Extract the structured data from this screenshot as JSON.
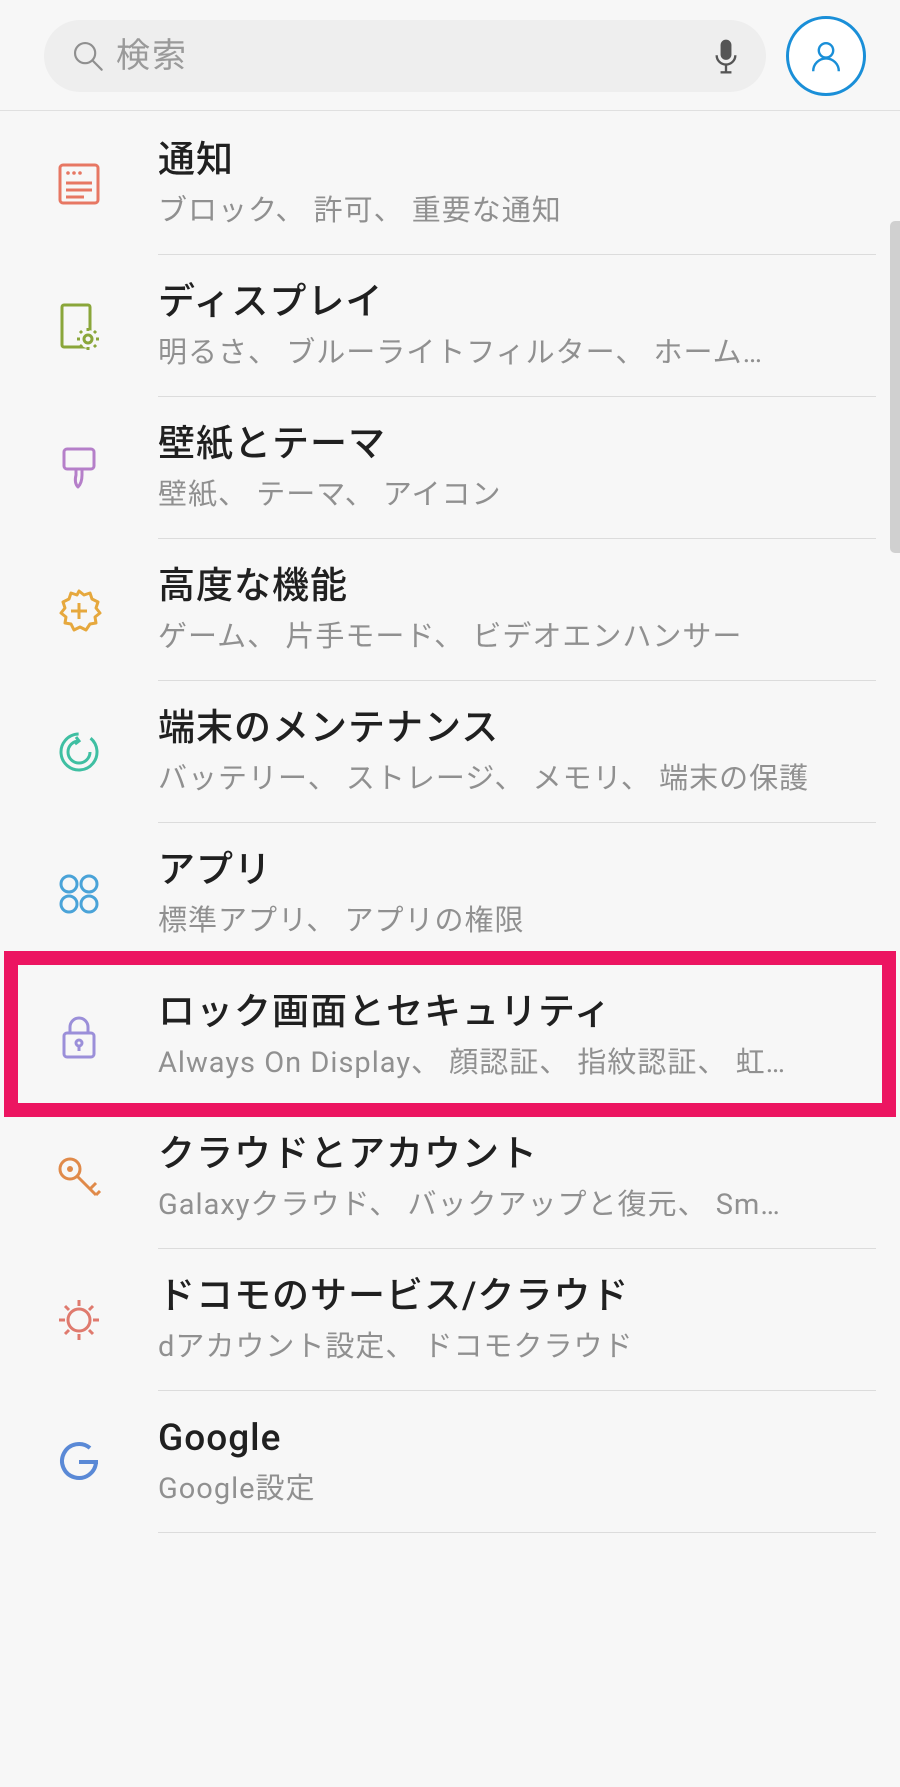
{
  "search": {
    "placeholder": "検索"
  },
  "colors": {
    "highlight": "#ec1561",
    "profileRing": "#1a8fd8"
  },
  "items": [
    {
      "iconName": "notifications-icon",
      "title": "通知",
      "subtitle": "ブロック、 許可、 重要な通知",
      "highlighted": false
    },
    {
      "iconName": "display-icon",
      "title": "ディスプレイ",
      "subtitle": "明るさ、 ブルーライトフィルター、 ホーム…",
      "highlighted": false
    },
    {
      "iconName": "wallpaper-icon",
      "title": "壁紙とテーマ",
      "subtitle": "壁紙、 テーマ、 アイコン",
      "highlighted": false
    },
    {
      "iconName": "advanced-features-icon",
      "title": "高度な機能",
      "subtitle": "ゲーム、 片手モード、 ビデオエンハンサー",
      "highlighted": false
    },
    {
      "iconName": "device-maintenance-icon",
      "title": "端末のメンテナンス",
      "subtitle": "バッテリー、 ストレージ、 メモリ、 端末の保護",
      "highlighted": false
    },
    {
      "iconName": "apps-icon",
      "title": "アプリ",
      "subtitle": "標準アプリ、 アプリの権限",
      "highlighted": false
    },
    {
      "iconName": "lock-icon",
      "title": "ロック画面とセキュリティ",
      "subtitle": "Always On Display、 顔認証、 指紋認証、 虹…",
      "highlighted": true
    },
    {
      "iconName": "cloud-accounts-icon",
      "title": "クラウドとアカウント",
      "subtitle": "Galaxyクラウド、 バックアップと復元、 Sm…",
      "highlighted": false
    },
    {
      "iconName": "docomo-services-icon",
      "title": "ドコモのサービス/クラウド",
      "subtitle": "dアカウント設定、 ドコモクラウド",
      "highlighted": false
    },
    {
      "iconName": "google-icon",
      "title": "Google",
      "subtitle": "Google設定",
      "highlighted": false
    }
  ]
}
